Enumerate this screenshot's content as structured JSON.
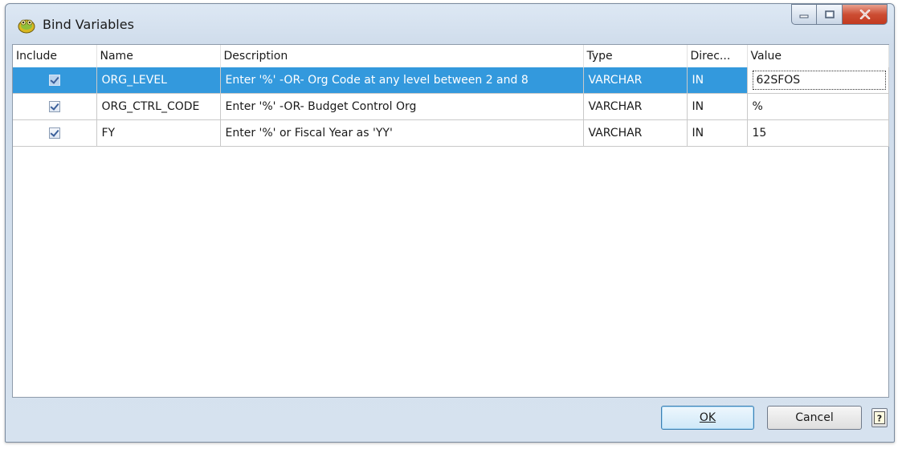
{
  "window": {
    "title": "Bind Variables",
    "icon": "toad-app-icon",
    "controls": {
      "minimize": "minimize-icon",
      "maximize": "maximize-icon",
      "close": "close-icon"
    }
  },
  "grid": {
    "headers": {
      "include": "Include",
      "name": "Name",
      "description": "Description",
      "type": "Type",
      "direction": "Direc...",
      "value": "Value"
    },
    "rows": [
      {
        "included": true,
        "name": "ORG_LEVEL",
        "description": "Enter '%' -OR- Org Code at any level between 2 and 8",
        "type": "VARCHAR",
        "direction": "IN",
        "value": "62SFOS"
      },
      {
        "included": true,
        "name": "ORG_CTRL_CODE",
        "description": "Enter '%' -OR- Budget Control Org",
        "type": "VARCHAR",
        "direction": "IN",
        "value": "%"
      },
      {
        "included": true,
        "name": "FY",
        "description": "Enter '%' or Fiscal Year as 'YY'",
        "type": "VARCHAR",
        "direction": "IN",
        "value": "15"
      }
    ],
    "selected_row": 0
  },
  "buttons": {
    "ok": "OK",
    "cancel": "Cancel",
    "help": "?"
  },
  "colors": {
    "selection": "#3399dd",
    "title_bar": "#dde8f4",
    "close_button": "#cc4d33"
  }
}
